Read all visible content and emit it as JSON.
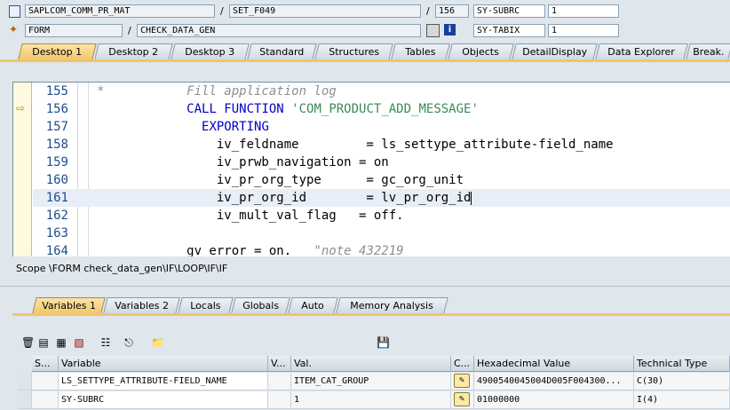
{
  "header": {
    "program": "SAPLCOM_COMM_PR_MAT",
    "include": "SET_F049",
    "line": "156",
    "var1_name": "SY-SUBRC",
    "var1_value": "1",
    "event_type": "FORM",
    "event_name": "CHECK_DATA_GEN",
    "var2_name": "SY-TABIX",
    "var2_value": "1",
    "slash": "/"
  },
  "tabs": [
    "Desktop 1",
    "Desktop 2",
    "Desktop 3",
    "Standard",
    "Structures",
    "Tables",
    "Objects",
    "DetailDisplay",
    "Data Explorer",
    "Break."
  ],
  "code": [
    {
      "ln": "155",
      "parts": [
        {
          "c": "cm",
          "t": "*           Fill application log"
        }
      ]
    },
    {
      "ln": "156",
      "parts": [
        {
          "c": "id",
          "t": "            "
        },
        {
          "c": "kw",
          "t": "CALL FUNCTION "
        },
        {
          "c": "st",
          "t": "'COM_PRODUCT_ADD_MESSAGE'"
        }
      ]
    },
    {
      "ln": "157",
      "parts": [
        {
          "c": "id",
          "t": "              "
        },
        {
          "c": "kw",
          "t": "EXPORTING"
        }
      ]
    },
    {
      "ln": "158",
      "parts": [
        {
          "c": "id",
          "t": "                iv_feldname         = ls_settype_attribute-field_name"
        }
      ]
    },
    {
      "ln": "159",
      "parts": [
        {
          "c": "id",
          "t": "                iv_prwb_navigation = on"
        }
      ]
    },
    {
      "ln": "160",
      "parts": [
        {
          "c": "id",
          "t": "                iv_pr_org_type      = gc_org_unit"
        }
      ]
    },
    {
      "ln": "161",
      "parts": [
        {
          "c": "id",
          "t": "                iv_pr_org_id        = lv_pr_org_id"
        }
      ]
    },
    {
      "ln": "162",
      "parts": [
        {
          "c": "id",
          "t": "                iv_mult_val_flag   = off."
        }
      ]
    },
    {
      "ln": "163",
      "parts": [
        {
          "c": "id",
          "t": ""
        }
      ]
    },
    {
      "ln": "164",
      "parts": [
        {
          "c": "id",
          "t": "            gv_error = on.   "
        },
        {
          "c": "cm",
          "t": "\"note 432219"
        }
      ]
    }
  ],
  "scope": "Scope \\FORM check_data_gen\\IF\\LOOP\\IF\\IF",
  "lower_tabs": [
    "Variables 1",
    "Variables 2",
    "Locals",
    "Globals",
    "Auto",
    "Memory Analysis"
  ],
  "table": {
    "headers": [
      "S...",
      "Variable",
      "V...",
      "Val.",
      "C...",
      "Hexadecimal Value",
      "Technical Type"
    ],
    "rows": [
      {
        "variable": "LS_SETTYPE_ATTRIBUTE-FIELD_NAME",
        "value": "ITEM_CAT_GROUP",
        "hex": "4900540045004D005F004300...",
        "type": "C(30)"
      },
      {
        "variable": "SY-SUBRC",
        "value": "1",
        "hex": "01000000",
        "type": "I(4)"
      }
    ]
  },
  "icons": {
    "program": "program-icon",
    "event": "event-icon",
    "code_indicator": "current-line-arrow-icon",
    "colors": {
      "accent": "#f2c56a",
      "keyword": "#0000c8",
      "string": "#3b8a57",
      "comment": "#8e8e8e"
    }
  }
}
